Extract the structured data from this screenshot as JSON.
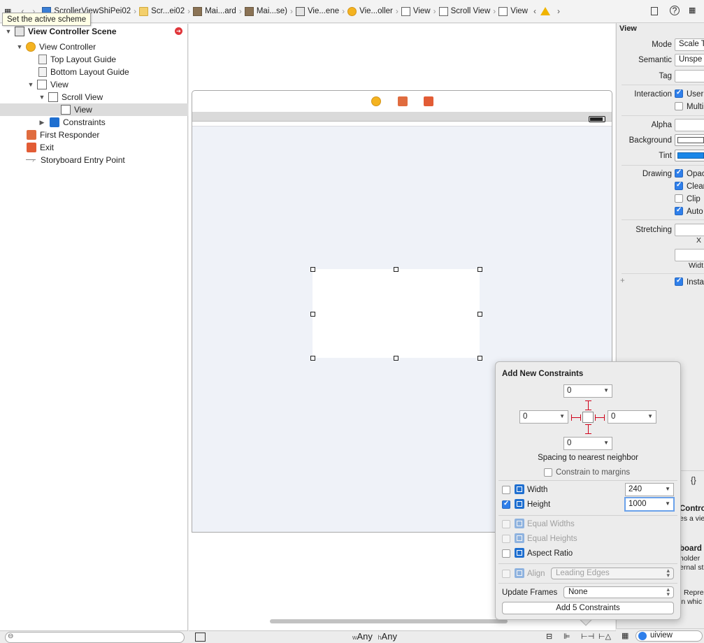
{
  "tooltip": "Set the active scheme",
  "jumpbar": {
    "items": [
      {
        "label": "ScrollerViewShiPei02",
        "icon": "xcode-project-icon"
      },
      {
        "label": "Scr...ei02",
        "icon": "folder-icon"
      },
      {
        "label": "Mai...ard",
        "icon": "storyboard-icon"
      },
      {
        "label": "Mai...se)",
        "icon": "storyboard-icon"
      },
      {
        "label": "Vie...ene",
        "icon": "scene-icon"
      },
      {
        "label": "Vie...oller",
        "icon": "view-controller-icon"
      },
      {
        "label": "View",
        "icon": "view-icon"
      },
      {
        "label": "Scroll View",
        "icon": "view-icon"
      },
      {
        "label": "View",
        "icon": "view-icon"
      }
    ]
  },
  "outline": {
    "rows": [
      {
        "label": "View Controller Scene",
        "bold": true,
        "icon": "scene-icon"
      },
      {
        "label": "View Controller",
        "icon": "view-controller-icon"
      },
      {
        "label": "Top Layout Guide",
        "icon": "layout-guide-icon"
      },
      {
        "label": "Bottom Layout Guide",
        "icon": "layout-guide-icon"
      },
      {
        "label": "View",
        "icon": "view-icon"
      },
      {
        "label": "Scroll View",
        "icon": "scroll-view-icon"
      },
      {
        "label": "View",
        "icon": "view-icon",
        "selected": true
      },
      {
        "label": "Constraints",
        "icon": "constraints-icon"
      },
      {
        "label": "First Responder",
        "icon": "first-responder-icon"
      },
      {
        "label": "Exit",
        "icon": "exit-icon"
      },
      {
        "label": "Storyboard Entry Point",
        "icon": "entry-arrow-icon"
      }
    ]
  },
  "size_class": {
    "w_prefix": "w",
    "w_value": "Any",
    "h_prefix": "h",
    "h_value": "Any"
  },
  "inspector": {
    "section_title": "View",
    "mode_label": "Mode",
    "mode_value": "Scale T",
    "semantic_label": "Semantic",
    "semantic_value": "Unspe",
    "tag_label": "Tag",
    "interaction_label": "Interaction",
    "user_label": "User",
    "multi_label": "Multi",
    "alpha_label": "Alpha",
    "background_label": "Background",
    "tint_label": "Tint",
    "drawing_label": "Drawing",
    "opaque_label": "Opac",
    "clears_label": "Clear",
    "clip_label": "Clip",
    "autoresize_label": "Auto",
    "stretching_label": "Stretching",
    "x_label": "X",
    "width_label": "Widt",
    "installed_label": "Insta",
    "plus_label": "+",
    "braces_label": "{}",
    "library_title_1": "Contro",
    "library_desc_1": "es a vie",
    "library_title_2": "board",
    "library_desc_2": "holder",
    "library_desc_3": "ernal st",
    "library_desc_4": "Repre",
    "library_desc_5": "in whic",
    "search_value": "uiview",
    "colors": {
      "tint": "#1a87e8",
      "accent": "#2f7fea"
    }
  },
  "popover": {
    "title": "Add New Constraints",
    "top_value": "0",
    "left_value": "0",
    "right_value": "0",
    "bottom_value": "0",
    "spacing_caption": "Spacing to nearest neighbor",
    "constrain_margins_label": "Constrain to margins",
    "width_label": "Width",
    "width_value": "240",
    "height_label": "Height",
    "height_value": "1000",
    "equal_widths_label": "Equal Widths",
    "equal_heights_label": "Equal Heights",
    "aspect_ratio_label": "Aspect Ratio",
    "align_label": "Align",
    "align_value": "Leading Edges",
    "update_frames_label": "Update Frames",
    "update_frames_value": "None",
    "add_button_label": "Add 5 Constraints",
    "colors": {
      "strut": "#d0021b"
    }
  }
}
